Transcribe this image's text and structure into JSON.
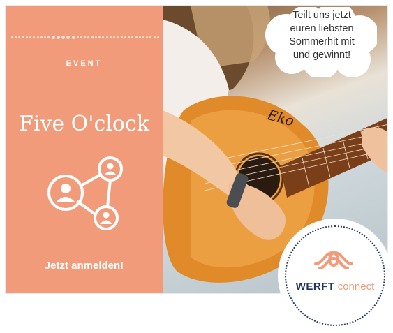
{
  "left_panel": {
    "kicker": "EVENT",
    "title": "Five O'clock",
    "cta_label": "Jetzt anmelden!",
    "background_color": "#f29b7a",
    "icon": "user-network-icon"
  },
  "bubble": {
    "lines": [
      "Teilt uns jetzt",
      "euren liebsten",
      "Sommerhit mit",
      "und gewinnt!"
    ]
  },
  "photo": {
    "guitar_brand": "Eko"
  },
  "logo": {
    "brand_bold": "WERFT",
    "brand_light": "connect",
    "icon": "rope-knot-icon",
    "navy": "#1e3560",
    "accent": "#f29b7a"
  }
}
